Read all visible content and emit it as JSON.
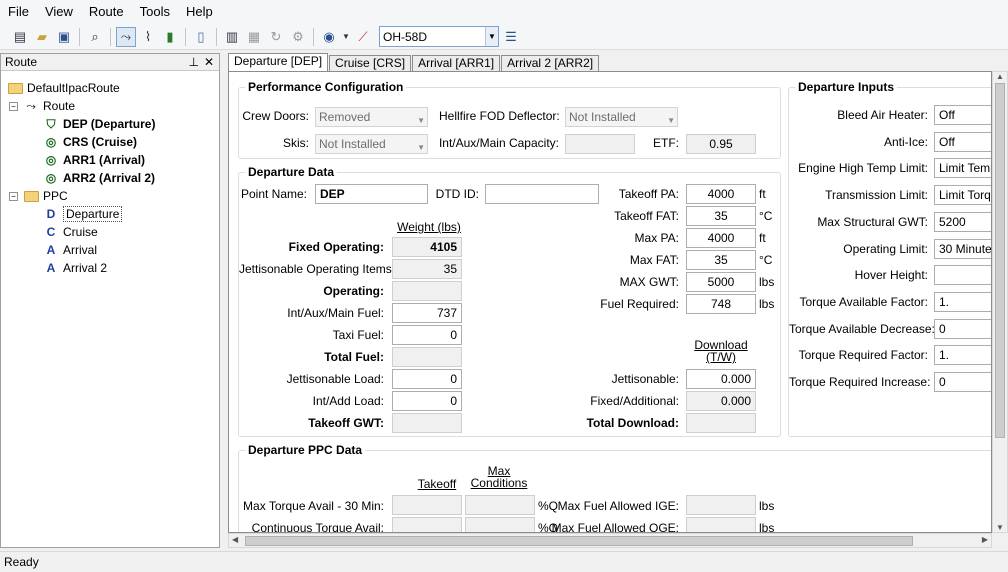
{
  "menu": [
    "File",
    "View",
    "Route",
    "Tools",
    "Help"
  ],
  "toolbar": {
    "aircraft": "OH-58D"
  },
  "route_panel": {
    "title": "Route",
    "root": "DefaultIpacRoute",
    "route_label": "Route",
    "route_items": [
      "DEP (Departure)",
      "CRS (Cruise)",
      "ARR1 (Arrival)",
      "ARR2 (Arrival 2)"
    ],
    "ppc_label": "PPC",
    "ppc_items": [
      "Departure",
      "Cruise",
      "Arrival",
      "Arrival 2"
    ]
  },
  "tabs": [
    "Departure [DEP]",
    "Cruise [CRS]",
    "Arrival [ARR1]",
    "Arrival 2 [ARR2]"
  ],
  "perf": {
    "title": "Performance Configuration",
    "crew_doors_label": "Crew Doors:",
    "crew_doors": "Removed",
    "hellfire_label": "Hellfire FOD Deflector:",
    "hellfire": "Not Installed",
    "skis_label": "Skis:",
    "skis": "Not Installed",
    "capacity_label": "Int/Aux/Main Capacity:",
    "capacity": "",
    "etf_label": "ETF:",
    "etf": "0.95"
  },
  "dep": {
    "title": "Departure Data",
    "point_name_label": "Point Name:",
    "point_name": "DEP",
    "dtd_label": "DTD ID:",
    "dtd": "",
    "weight_header": "Weight (lbs)",
    "fixed_operating_label": "Fixed Operating:",
    "fixed_operating": "4105",
    "jett_items_label": "Jettisonable Operating Items:",
    "jett_items": "35",
    "operating_label": "Operating:",
    "operating": "",
    "fuel_label": "Int/Aux/Main Fuel:",
    "fuel": "737",
    "taxi_label": "Taxi Fuel:",
    "taxi": "0",
    "total_fuel_label": "Total Fuel:",
    "total_fuel": "",
    "jett_load_label": "Jettisonable Load:",
    "jett_load": "0",
    "add_load_label": "Int/Add Load:",
    "add_load": "0",
    "takeoff_gwt_label": "Takeoff GWT:",
    "takeoff_gwt": "",
    "takeoff_pa_label": "Takeoff PA:",
    "takeoff_pa": "4000",
    "takeoff_pa_unit": "ft",
    "takeoff_fat_label": "Takeoff FAT:",
    "takeoff_fat": "35",
    "takeoff_fat_unit": "°C",
    "max_pa_label": "Max PA:",
    "max_pa": "4000",
    "max_pa_unit": "ft",
    "max_fat_label": "Max FAT:",
    "max_fat": "35",
    "max_fat_unit": "°C",
    "max_gwt_label": "MAX GWT:",
    "max_gwt": "5000",
    "max_gwt_unit": "lbs",
    "fuel_req_label": "Fuel Required:",
    "fuel_req": "748",
    "fuel_req_unit": "lbs",
    "download_header": "Download (T/W)",
    "jettisonable_label": "Jettisonable:",
    "jettisonable": "0.000",
    "fixed_add_label": "Fixed/Additional:",
    "fixed_add": "0.000",
    "total_download_label": "Total Download:",
    "total_download": ""
  },
  "inputs": {
    "title": "Departure Inputs",
    "rows": [
      {
        "label": "Bleed Air Heater:",
        "value": "Off"
      },
      {
        "label": "Anti-Ice:",
        "value": "Off"
      },
      {
        "label": "Engine High Temp Limit:",
        "value": "Limit Temp"
      },
      {
        "label": "Transmission Limit:",
        "value": "Limit Torque"
      },
      {
        "label": "Max Structural GWT:",
        "value": "5200"
      },
      {
        "label": "Operating Limit:",
        "value": "30 Minute"
      },
      {
        "label": "Hover Height:",
        "value": ""
      },
      {
        "label": "Torque Available Factor:",
        "value": "1."
      },
      {
        "label": "Torque Available Decrease:",
        "value": "0"
      },
      {
        "label": "Torque Required Factor:",
        "value": "1."
      },
      {
        "label": "Torque Required Increase:",
        "value": "0"
      }
    ]
  },
  "ppc": {
    "title": "Departure PPC Data",
    "takeoff_header": "Takeoff",
    "max_header": "Max Conditions",
    "max_torque_label": "Max Torque Avail - 30 Min:",
    "cont_torque_label": "Continuous Torque Avail:",
    "pct_q": "%Q",
    "max_fuel_ige_label": "Max Fuel Allowed IGE:",
    "max_fuel_oge_label": "Max Fuel Allowed OGE:",
    "lbs": "lbs"
  },
  "status": "Ready"
}
